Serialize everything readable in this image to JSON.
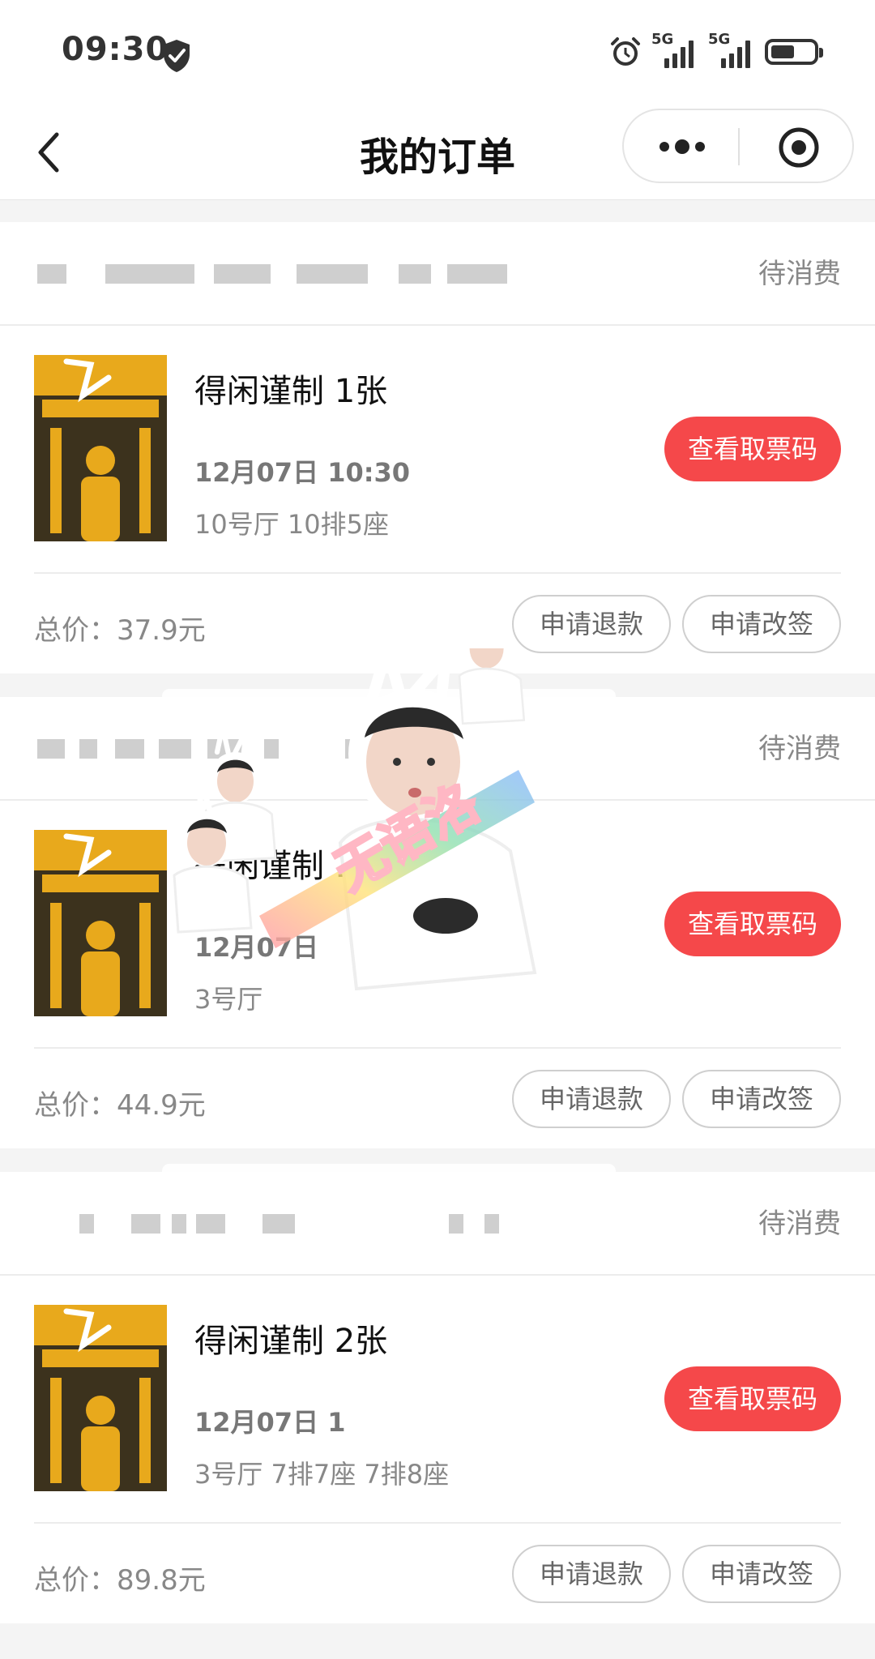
{
  "status_bar": {
    "time": "09:30",
    "signal1": "5G",
    "signal2": "5G"
  },
  "nav": {
    "title": "我的订单"
  },
  "orders": [
    {
      "status": "待消费",
      "movie": "得闲谨制 1张",
      "time": "12月07日 10:30",
      "seat": "10号厅 10排5座",
      "ticket_button": "查看取票码",
      "total": "总价：37.9元",
      "refund": "申请退款",
      "change": "申请改签"
    },
    {
      "status": "待消费",
      "movie": "得闲谨制 1张",
      "time": "12月07日",
      "seat": "3号厅",
      "ticket_button": "查看取票码",
      "total": "总价：44.9元",
      "refund": "申请退款",
      "change": "申请改签"
    },
    {
      "status": "待消费",
      "movie": "得闲谨制 2张",
      "time": "12月07日 1",
      "seat": "3号厅 7排7座 7排8座",
      "ticket_button": "查看取票码",
      "total": "总价：89.8元",
      "refund": "申请退款",
      "change": "申请改签"
    }
  ],
  "sticker": {
    "text": "无语洛"
  },
  "colors": {
    "accent": "#f5484a",
    "poster_yellow": "#e8a91c"
  },
  "icons": {
    "shield": "shield-icon",
    "back": "back-icon",
    "more": "more-icon",
    "target": "target-icon"
  }
}
